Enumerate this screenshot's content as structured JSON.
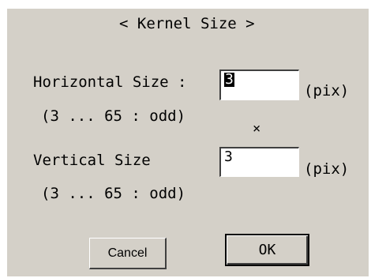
{
  "dialog": {
    "title": "< Kernel Size >",
    "horizontal": {
      "label": "Horizontal Size :",
      "range": "(3 ... 65 : odd)",
      "value": "3",
      "unit": "(pix)"
    },
    "separator": "×",
    "vertical": {
      "label": "Vertical Size",
      "range": "(3 ... 65 : odd)",
      "value": "3",
      "unit": "(pix)"
    },
    "buttons": {
      "cancel": "Cancel",
      "ok": "OK"
    }
  },
  "colors": {
    "dialog_background": "#d4d0c8",
    "field_background": "#ffffff",
    "text": "#000000"
  }
}
